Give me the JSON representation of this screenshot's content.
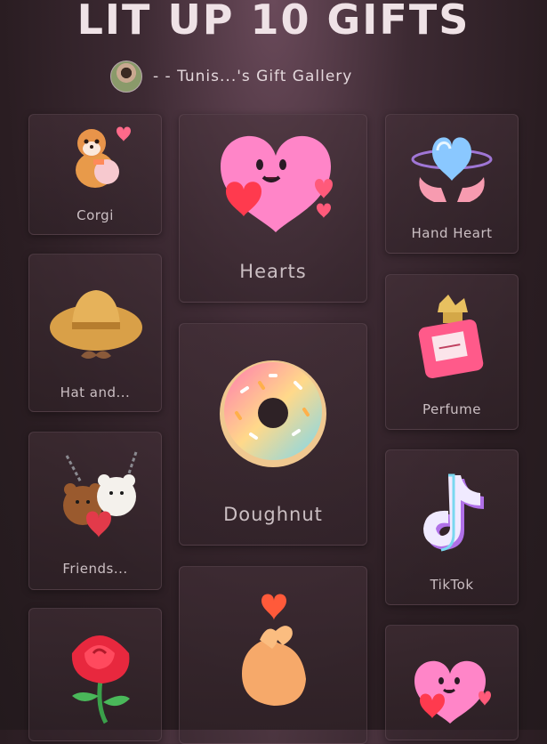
{
  "header": {
    "title": "LIT UP 10 GIFTS",
    "subtitle": "- - Tunis...'s Gift Gallery"
  },
  "gifts": [
    {
      "name": "Corgi",
      "icon": "corgi-icon"
    },
    {
      "name": "Hat and...",
      "icon": "hat-mustache-icon"
    },
    {
      "name": "Friends...",
      "icon": "bears-friends-icon"
    },
    {
      "name": "Hearts",
      "icon": "heart-character-icon"
    },
    {
      "name": "Doughnut",
      "icon": "doughnut-icon"
    },
    {
      "name": "Hand Heart",
      "icon": "hand-heart-icon"
    },
    {
      "name": "Perfume",
      "icon": "perfume-icon"
    },
    {
      "name": "TikTok",
      "icon": "tiktok-icon"
    }
  ]
}
